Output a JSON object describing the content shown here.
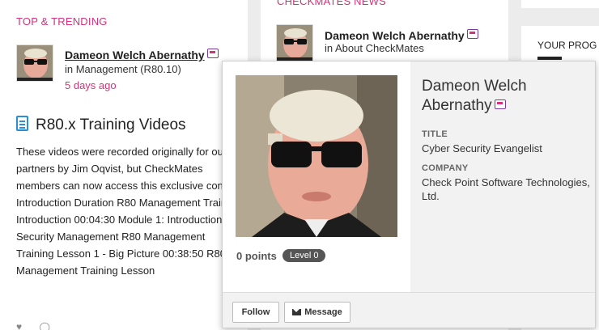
{
  "left": {
    "section_title": "TOP & TRENDING",
    "author": "Dameon Welch Abernathy",
    "location": "in Management (R80.10)",
    "time": "5 days ago",
    "doc_title": "R80.x Training Videos",
    "body": "These videos were recorded originally for our partners by Jim Oqvist, but CheckMates members can now access this exclusive content! Introduction Duration R80 Management Training Introduction 00:04:30  Module 1: Introduction to Security Management R80 Management Training Lesson 1 - Big Picture 00:38:50 R80 Management Training Lesson"
  },
  "middle": {
    "section_title": "CHECKMATES NEWS",
    "author": "Dameon Welch Abernathy",
    "location": "in About CheckMates"
  },
  "right": {
    "label": "YOUR PROG"
  },
  "popover": {
    "name": "Dameon Welch Abernathy",
    "title_label": "TITLE",
    "title_value": "Cyber Security Evangelist",
    "company_label": "COMPANY",
    "company_value": "Check Point Software Technologies, Ltd.",
    "points": "0 points",
    "level": "Level 0",
    "follow_label": "Follow",
    "message_label": "Message"
  },
  "colors": {
    "accent": "#d6317a",
    "doc_icon": "#2a8fd6"
  }
}
